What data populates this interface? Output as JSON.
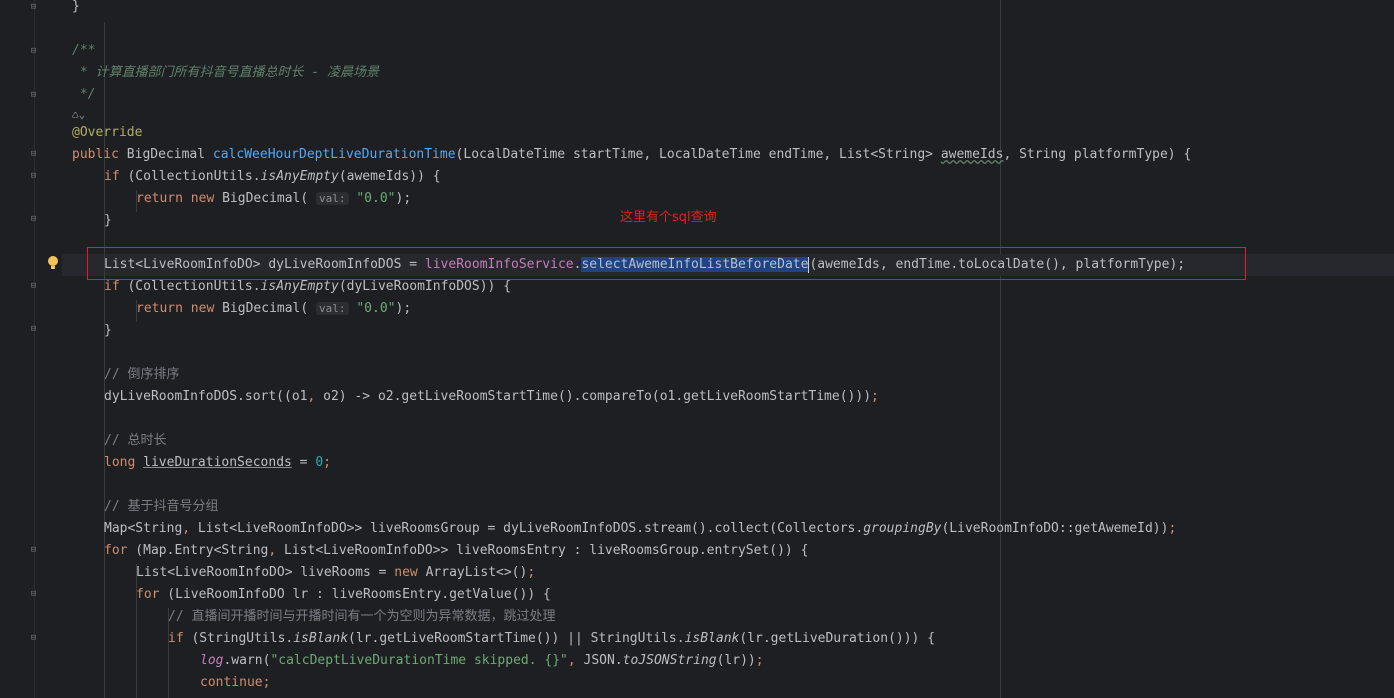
{
  "annotation": {
    "text": "这里有个sql查询",
    "color": "#e02020"
  },
  "inlay_hint": "val:",
  "code": {
    "l0": "}",
    "l1": "/**",
    "l2": " * 计算直播部门所有抖音号直播总时长 - 凌晨场景",
    "l3": " */",
    "l4": "@Override",
    "l5_kw": "public",
    "l5_type": "BigDecimal",
    "l5_fn": "calcWeeHourDeptLiveDurationTime",
    "l5_params1": "(LocalDateTime startTime, LocalDateTime endTime, List<String> ",
    "l5_param": "awemeIds",
    "l5_params2": ", String platformType) {",
    "l6_kw": "if",
    "l6_a": " (CollectionUtils.",
    "l6_m": "isAnyEmpty",
    "l6_b": "(awemeIds)) {",
    "l7_kw1": "return",
    "l7_kw2": "new",
    "l7_a": " BigDecimal( ",
    "l7_str": "\"0.0\"",
    "l7_b": ");",
    "l8": "}",
    "l10_a": "List<LiveRoomInfoDO> dyLiveRoomInfoDOS = ",
    "l10_field": "liveRoomInfoService",
    "l10_dot": ".",
    "l10_sel": "selectAwemeInfoListBeforeDate",
    "l10_b": "(awemeIds, endTime.toLocalDate(), platformType);",
    "l11_kw": "if",
    "l11_a": " (CollectionUtils.",
    "l11_m": "isAnyEmpty",
    "l11_b": "(dyLiveRoomInfoDOS)) {",
    "l12_kw1": "return",
    "l12_kw2": "new",
    "l12_a": " BigDecimal( ",
    "l12_str": "\"0.0\"",
    "l12_b": ");",
    "l13": "}",
    "l15": "// 倒序排序",
    "l16_a": "dyLiveRoomInfoDOS.sort((o1",
    "l16_c1": ",",
    "l16_b": " o2) -> o2.getLiveRoomStartTime().compareTo(o1.getLiveRoomStartTime()))",
    "l16_semi": ";",
    "l18": "// 总时长",
    "l19_kw": "long",
    "l19_var": "liveDurationSeconds",
    "l19_eq": " = ",
    "l19_num": "0",
    "l19_semi": ";",
    "l21": "// 基于抖音号分组",
    "l22_a": "Map<String",
    "l22_c": ",",
    "l22_b": " List<LiveRoomInfoDO>> liveRoomsGroup = dyLiveRoomInfoDOS.stream().collect(Collectors.",
    "l22_m": "groupingBy",
    "l22_d": "(LiveRoomInfoDO::getAwemeId))",
    "l22_semi": ";",
    "l23_kw": "for",
    "l23_a": " (Map.Entry<String",
    "l23_c": ",",
    "l23_b": " List<LiveRoomInfoDO>> liveRoomsEntry : liveRoomsGroup.entrySet()) {",
    "l24_a": "List<LiveRoomInfoDO> liveRooms = ",
    "l24_kw": "new",
    "l24_b": " ArrayList<>()",
    "l24_semi": ";",
    "l25_kw": "for",
    "l25_a": " (LiveRoomInfoDO lr : liveRoomsEntry.getValue()) {",
    "l26": "// 直播间开播时间与开播时间有一个为空则为异常数据，跳过处理",
    "l27_kw": "if",
    "l27_a": " (StringUtils.",
    "l27_m1": "isBlank",
    "l27_b": "(lr.getLiveRoomStartTime()) || StringUtils.",
    "l27_m2": "isBlank",
    "l27_c": "(lr.getLiveDuration())) {",
    "l28_field": "log",
    "l28_a": ".warn(",
    "l28_str": "\"calcDeptLiveDurationTime skipped. {}\"",
    "l28_c": ",",
    "l28_b": " JSON.",
    "l28_m": "toJSONString",
    "l28_d": "(lr))",
    "l28_semi": ";",
    "l29_kw": "continue",
    "l29_semi": ";"
  }
}
